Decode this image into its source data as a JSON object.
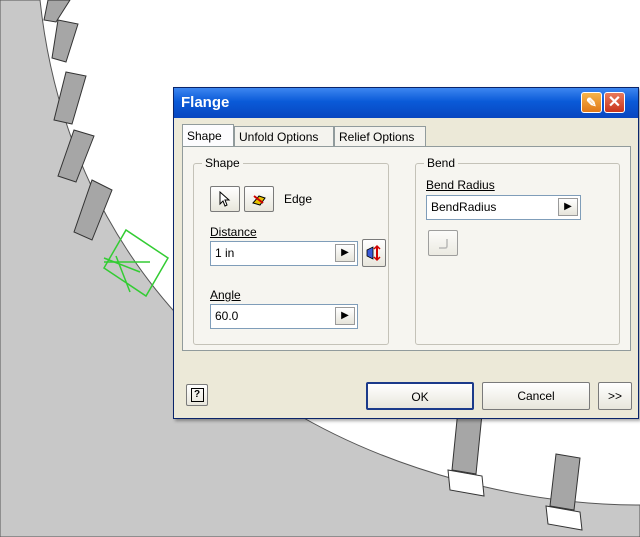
{
  "dialog": {
    "title": "Flange",
    "title_buttons": {
      "help_icon": "help-pen-icon",
      "close_icon": "close-icon",
      "close_glyph": "✕"
    },
    "tabs": [
      {
        "label": "Shape",
        "active": true
      },
      {
        "label": "Unfold Options",
        "active": false
      },
      {
        "label": "Relief Options",
        "active": false
      }
    ],
    "shape_group": {
      "legend": "Shape",
      "edge_label": "Edge",
      "distance": {
        "label": "Distance",
        "value": "1 in"
      },
      "angle": {
        "label": "Angle",
        "value": "60.0"
      }
    },
    "bend_group": {
      "legend": "Bend",
      "bend_radius": {
        "label": "Bend Radius",
        "value": "BendRadius"
      }
    },
    "footer": {
      "help_glyph": "?",
      "ok_label": "OK",
      "cancel_label": "Cancel",
      "more_label": ">>"
    }
  },
  "colors": {
    "titlebar": "#0a5ad8",
    "dialog_face": "#ece9d8",
    "sketch_green": "#33cc33",
    "model_gray": "#c8c8c8"
  }
}
